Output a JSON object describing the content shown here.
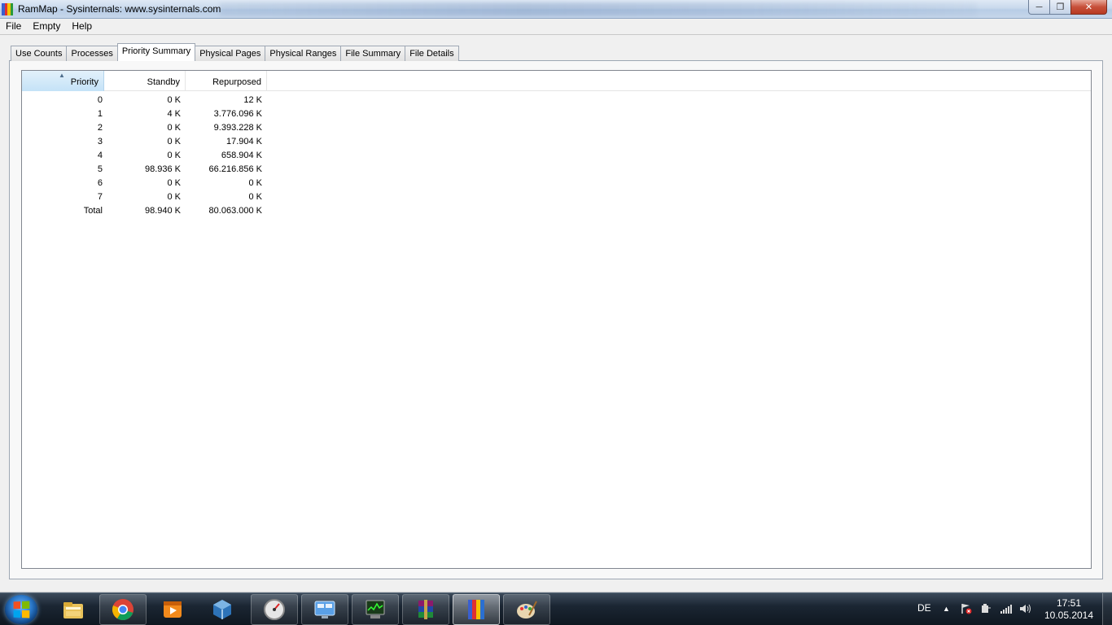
{
  "window": {
    "title": "RamMap - Sysinternals: www.sysinternals.com",
    "icon_colors": [
      "#3a5fd0",
      "#e03030",
      "#f5c400",
      "#2a9a3a"
    ]
  },
  "menu": [
    "File",
    "Empty",
    "Help"
  ],
  "tabs": [
    {
      "label": "Use Counts"
    },
    {
      "label": "Processes"
    },
    {
      "label": "Priority Summary",
      "active": true
    },
    {
      "label": "Physical Pages"
    },
    {
      "label": "Physical Ranges"
    },
    {
      "label": "File Summary"
    },
    {
      "label": "File Details"
    }
  ],
  "table": {
    "columns": [
      "Priority",
      "Standby",
      "Repurposed"
    ],
    "sorted_column": "Priority",
    "rows": [
      [
        "0",
        "0 K",
        "12 K"
      ],
      [
        "1",
        "4 K",
        "3.776.096 K"
      ],
      [
        "2",
        "0 K",
        "9.393.228 K"
      ],
      [
        "3",
        "0 K",
        "17.904 K"
      ],
      [
        "4",
        "0 K",
        "658.904 K"
      ],
      [
        "5",
        "98.936 K",
        "66.216.856 K"
      ],
      [
        "6",
        "0 K",
        "0 K"
      ],
      [
        "7",
        "0 K",
        "0 K"
      ],
      [
        "Total",
        "98.940 K",
        "80.063.000 K"
      ]
    ]
  },
  "taskbar": {
    "apps": [
      "explorer-icon",
      "chrome-icon",
      "media-player-icon",
      "virtualbox-icon",
      "speedometer-icon",
      "control-panel-icon",
      "task-manager-icon",
      "winrar-icon",
      "rammap-icon",
      "paint-icon"
    ],
    "language": "DE",
    "time": "17:51",
    "date": "10.05.2014"
  }
}
